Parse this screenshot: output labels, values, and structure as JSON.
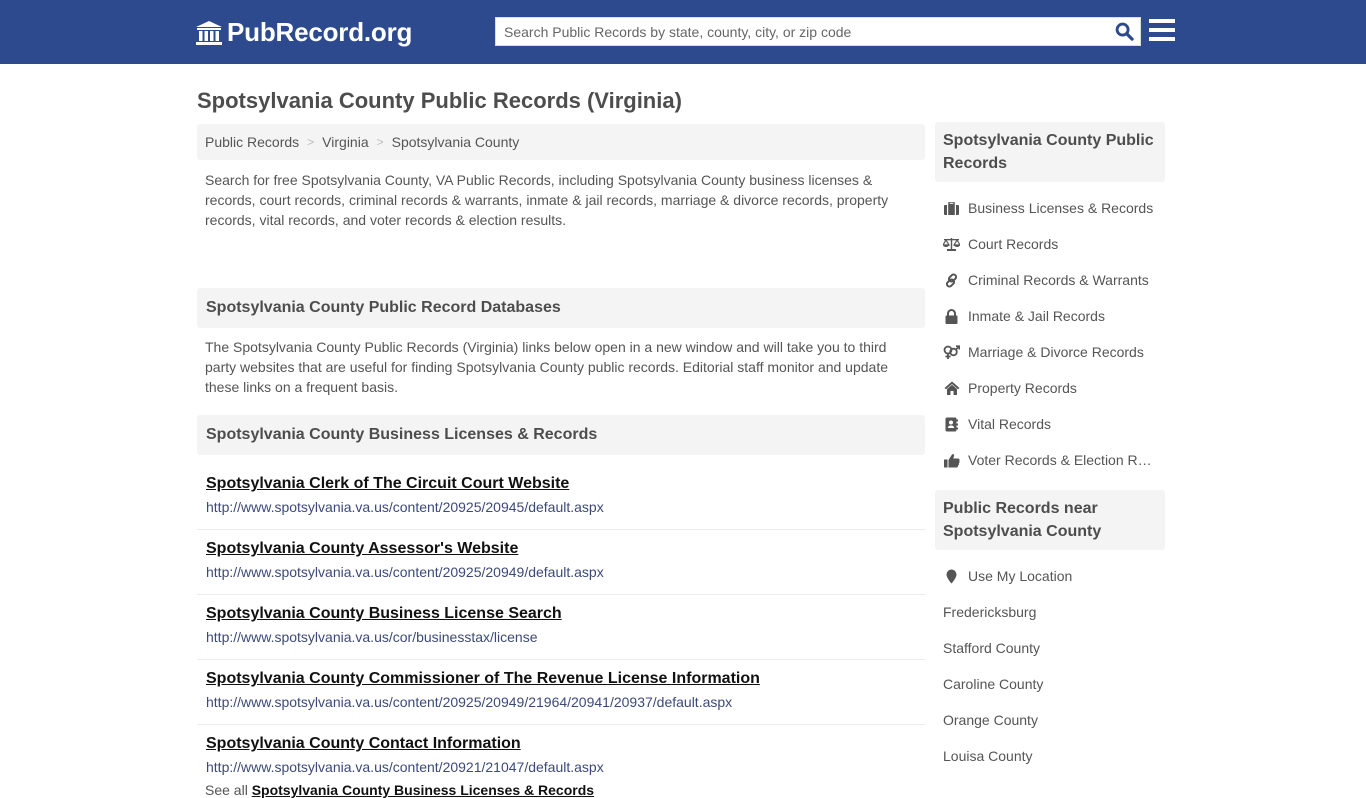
{
  "header": {
    "logo_text": "PubRecord.org",
    "search_placeholder": "Search Public Records by state, county, city, or zip code",
    "search_value": "",
    "colors": {
      "header_bg": "#2e4a8e",
      "search_icon": "#2e4a8e"
    }
  },
  "page": {
    "title": "Spotsylvania County Public Records (Virginia)"
  },
  "breadcrumb": [
    {
      "label": "Public Records"
    },
    {
      "label": "Virginia"
    },
    {
      "label": "Spotsylvania County"
    }
  ],
  "breadcrumb_separator": ">",
  "intro": "Search for free Spotsylvania County, VA Public Records, including Spotsylvania County business licenses & records, court records, criminal records & warrants, inmate & jail records, marriage & divorce records, property records, vital records, and voter records & election results.",
  "databases": {
    "heading": "Spotsylvania County Public Record Databases",
    "text": "The Spotsylvania County Public Records (Virginia) links below open in a new window and will take you to third party websites that are useful for finding Spotsylvania County public records. Editorial staff monitor and update these links on a frequent basis."
  },
  "business": {
    "heading": "Spotsylvania County Business Licenses & Records",
    "links": [
      {
        "title": "Spotsylvania Clerk of The Circuit Court Website",
        "url": "http://www.spotsylvania.va.us/content/20925/20945/default.aspx"
      },
      {
        "title": "Spotsylvania County Assessor's Website",
        "url": "http://www.spotsylvania.va.us/content/20925/20949/default.aspx"
      },
      {
        "title": "Spotsylvania County Business License Search",
        "url": "http://www.spotsylvania.va.us/cor/businesstax/license"
      },
      {
        "title": "Spotsylvania County Commissioner of The Revenue License Information",
        "url": "http://www.spotsylvania.va.us/content/20925/20949/21964/20941/20937/default.aspx"
      },
      {
        "title": "Spotsylvania County Contact Information",
        "url": "http://www.spotsylvania.va.us/content/20921/21047/default.aspx"
      }
    ],
    "see_all_prefix": "See all",
    "see_all_link": "Spotsylvania County Business Licenses & Records"
  },
  "sidebar": {
    "records_heading": "Spotsylvania County Public Records",
    "records": [
      {
        "icon": "briefcase-icon",
        "label": "Business Licenses & Records"
      },
      {
        "icon": "balance-scale-icon",
        "label": "Court Records"
      },
      {
        "icon": "link-icon",
        "label": "Criminal Records & Warrants"
      },
      {
        "icon": "lock-icon",
        "label": "Inmate & Jail Records"
      },
      {
        "icon": "venus-mars-icon",
        "label": "Marriage & Divorce Records"
      },
      {
        "icon": "home-icon",
        "label": "Property Records"
      },
      {
        "icon": "address-book-icon",
        "label": "Vital Records"
      },
      {
        "icon": "thumbs-up-icon",
        "label": "Voter Records & Election Results"
      }
    ],
    "near_heading": "Public Records near Spotsylvania County",
    "use_location": "Use My Location",
    "nearby": [
      "Fredericksburg",
      "Stafford County",
      "Caroline County",
      "Orange County",
      "Louisa County"
    ]
  }
}
